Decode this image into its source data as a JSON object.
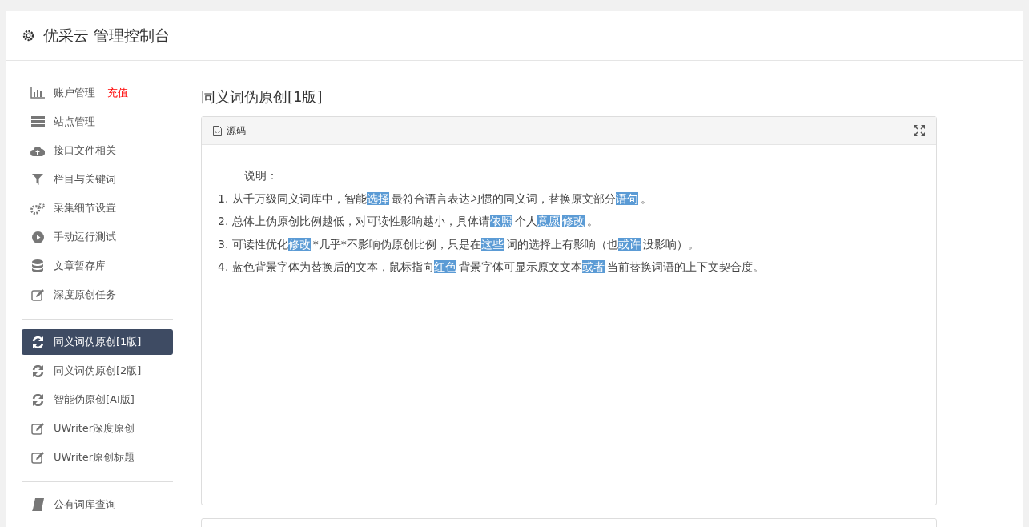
{
  "header": {
    "title": "优采云 管理控制台"
  },
  "sidebar": {
    "groups": [
      {
        "items": [
          {
            "label": "账户管理",
            "badge": "充值",
            "selected": false
          },
          {
            "label": "站点管理",
            "selected": false
          },
          {
            "label": "接口文件相关",
            "selected": false
          },
          {
            "label": "栏目与关键词",
            "selected": false
          },
          {
            "label": "采集细节设置",
            "selected": false
          },
          {
            "label": "手动运行测试",
            "selected": false
          },
          {
            "label": "文章暂存库",
            "selected": false
          },
          {
            "label": "深度原创任务",
            "selected": false
          }
        ]
      },
      {
        "items": [
          {
            "label": "同义词伪原创[1版]",
            "selected": true
          },
          {
            "label": "同义词伪原创[2版]",
            "selected": false
          },
          {
            "label": "智能伪原创[AI版]",
            "selected": false
          },
          {
            "label": "UWriter深度原创",
            "selected": false
          },
          {
            "label": "UWriter原创标题",
            "selected": false
          }
        ]
      },
      {
        "items": [
          {
            "label": "公有词库查询",
            "selected": false
          }
        ]
      }
    ]
  },
  "main": {
    "title": "同义词伪原创[1版]",
    "panel": {
      "tab": "源码",
      "heading": "说明：",
      "lines": [
        [
          {
            "text": "1. 从千万级同义词库中，智能",
            "highlighted": false
          },
          {
            "text": "选择",
            "highlighted": true
          },
          {
            "text": "最符合语言表达习惯的同义词，替换原文部分",
            "highlighted": false
          },
          {
            "text": "语句",
            "highlighted": true
          },
          {
            "text": "。",
            "highlighted": false
          }
        ],
        [
          {
            "text": "2. 总体上伪原创比例越低，对可读性影响越小，具体请",
            "highlighted": false
          },
          {
            "text": "依照",
            "highlighted": true
          },
          {
            "text": "个人",
            "highlighted": false
          },
          {
            "text": "意愿",
            "highlighted": true
          },
          {
            "text": "修改",
            "highlighted": true
          },
          {
            "text": "。",
            "highlighted": false
          }
        ],
        [
          {
            "text": "3. 可读性优化",
            "highlighted": false
          },
          {
            "text": "修改",
            "highlighted": true
          },
          {
            "text": "*几乎*不影响伪原创比例，只是在",
            "highlighted": false
          },
          {
            "text": "这些",
            "highlighted": true
          },
          {
            "text": "词的选择上有影响（也",
            "highlighted": false
          },
          {
            "text": "或许",
            "highlighted": true
          },
          {
            "text": "没影响）。",
            "highlighted": false
          }
        ],
        [
          {
            "text": "4. 蓝色背景字体为替换后的文本，鼠标指向",
            "highlighted": false
          },
          {
            "text": "红色",
            "highlighted": true
          },
          {
            "text": "背景字体可显示原文文本",
            "highlighted": false
          },
          {
            "text": "或者",
            "highlighted": true
          },
          {
            "text": "当前替换词语的上下文契合度。",
            "highlighted": false
          }
        ]
      ]
    }
  },
  "footer_panel": {
    "kind": "panel"
  }
}
